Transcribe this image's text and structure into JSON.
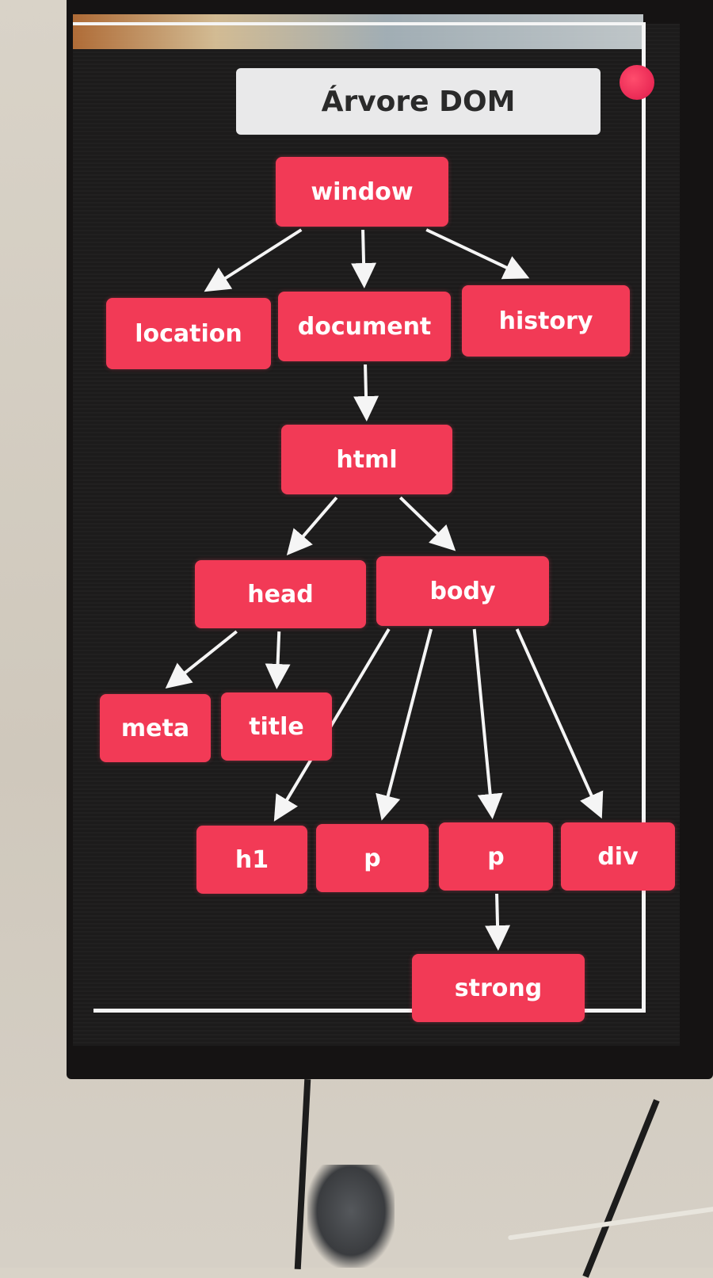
{
  "diagram": {
    "title": "Árvore DOM",
    "colors": {
      "node_fill": "#f23a56",
      "node_text": "#ffffff",
      "edge": "#f5f5f5",
      "screen": "#1c1b1b",
      "title_fill": "#e9e9ea"
    },
    "nodes": [
      {
        "id": "window",
        "label": "window"
      },
      {
        "id": "location",
        "label": "location"
      },
      {
        "id": "document",
        "label": "document"
      },
      {
        "id": "history",
        "label": "history"
      },
      {
        "id": "html",
        "label": "html"
      },
      {
        "id": "head",
        "label": "head"
      },
      {
        "id": "body",
        "label": "body"
      },
      {
        "id": "meta",
        "label": "meta"
      },
      {
        "id": "title",
        "label": "title"
      },
      {
        "id": "h1",
        "label": "h1"
      },
      {
        "id": "p1",
        "label": "p"
      },
      {
        "id": "p2",
        "label": "p"
      },
      {
        "id": "div",
        "label": "div"
      },
      {
        "id": "strong",
        "label": "strong"
      }
    ],
    "edges": [
      {
        "from": "window",
        "to": "location"
      },
      {
        "from": "window",
        "to": "document"
      },
      {
        "from": "window",
        "to": "history"
      },
      {
        "from": "document",
        "to": "html"
      },
      {
        "from": "html",
        "to": "head"
      },
      {
        "from": "html",
        "to": "body"
      },
      {
        "from": "head",
        "to": "meta"
      },
      {
        "from": "head",
        "to": "title"
      },
      {
        "from": "body",
        "to": "h1"
      },
      {
        "from": "body",
        "to": "p1"
      },
      {
        "from": "body",
        "to": "p2"
      },
      {
        "from": "body",
        "to": "div"
      },
      {
        "from": "p2",
        "to": "strong"
      }
    ]
  }
}
